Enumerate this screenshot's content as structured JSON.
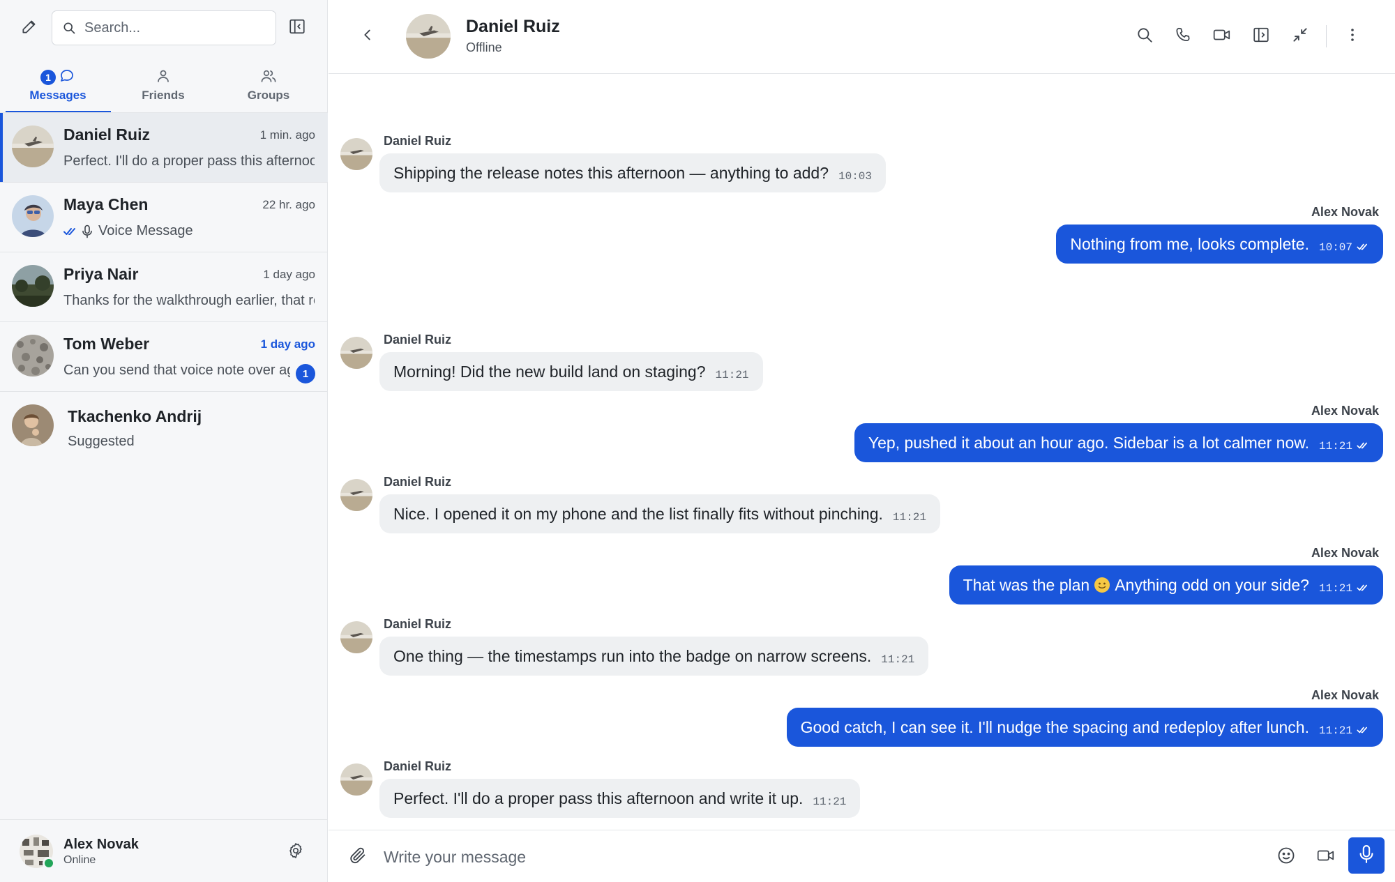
{
  "sidebar": {
    "search_placeholder": "Search...",
    "tabs": [
      {
        "label": "Messages",
        "badge": "1",
        "active": true
      },
      {
        "label": "Friends"
      },
      {
        "label": "Groups"
      }
    ],
    "conversations": [
      {
        "name": "Daniel Ruiz",
        "time": "1 min. ago",
        "preview": "Perfect. I'll do a proper pass this afternoon and write it up."
      },
      {
        "name": "Maya Chen",
        "time": "22 hr. ago",
        "preview": "Voice Message"
      },
      {
        "name": "Priya Nair",
        "time": "1 day ago",
        "preview": "Thanks for the walkthrough earlier, that really helped."
      },
      {
        "name": "Tom Weber",
        "time": "1 day ago",
        "preview": "Can you send that voice note over again?",
        "unread": "1"
      },
      {
        "name": "Tkachenko Andrij",
        "preview": "Suggested"
      }
    ],
    "user": {
      "name": "Alex Novak",
      "status": "Online"
    }
  },
  "chat": {
    "contact_name": "Daniel Ruiz",
    "contact_status": "Offline",
    "messages": [
      {
        "dir": "in",
        "author": "Daniel Ruiz",
        "text": "Shipping the release notes this afternoon — anything to add?",
        "time": "10:03"
      },
      {
        "dir": "out",
        "author": "Alex Novak",
        "text": "Nothing from me, looks complete.",
        "time": "10:07"
      },
      {
        "dir": "in",
        "author": "Daniel Ruiz",
        "text": "Morning! Did the new build land on staging?",
        "time": "11:21"
      },
      {
        "dir": "out",
        "author": "Alex Novak",
        "text": "Yep, pushed it about an hour ago. Sidebar is a lot calmer now.",
        "time": "11:21"
      },
      {
        "dir": "in",
        "author": "Daniel Ruiz",
        "text": "Nice. I opened it on my phone and the list finally fits without pinching.",
        "time": "11:21"
      },
      {
        "dir": "out",
        "author": "Alex Novak",
        "text_before": "That was the plan",
        "emoji": "slightly-smiling-face",
        "text_after": "Anything odd on your side?",
        "time": "11:21"
      },
      {
        "dir": "in",
        "author": "Daniel Ruiz",
        "text": "One thing — the timestamps run into the badge on narrow screens.",
        "time": "11:21"
      },
      {
        "dir": "out",
        "author": "Alex Novak",
        "text": "Good catch, I can see it. I'll nudge the spacing and redeploy after lunch.",
        "time": "11:21"
      },
      {
        "dir": "in",
        "author": "Daniel Ruiz",
        "text": "Perfect. I'll do a proper pass this afternoon and write it up.",
        "time": "11:21"
      }
    ],
    "composer_placeholder": "Write your message"
  },
  "colors": {
    "accent": "#1a56db",
    "online": "#22a559",
    "incoming_bubble": "#eef0f2",
    "sidebar_bg": "#f6f7f9"
  },
  "icons": [
    "compose-icon",
    "search-icon",
    "sidebar-collapse-icon",
    "chat-bubble-icon",
    "user-icon",
    "users-icon",
    "double-check-icon",
    "microphone-icon",
    "gear-icon",
    "chevron-left-icon",
    "phone-icon",
    "video-icon",
    "panel-icon",
    "minimize-icon",
    "more-vertical-icon",
    "paperclip-icon",
    "smiley-icon"
  ]
}
